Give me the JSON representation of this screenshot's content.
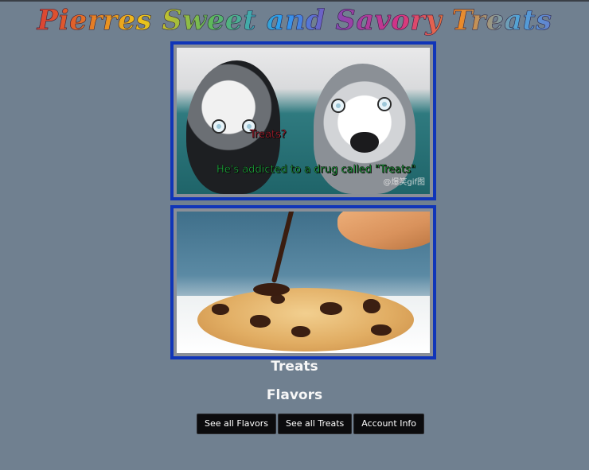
{
  "site": {
    "title": "Pierres Sweet and Savory Treats"
  },
  "gallery": {
    "dogs_image": {
      "caption_question": "Treats?",
      "caption_answer": "He's addicted to a drug called \"Treats\"",
      "watermark": "@爆笑gif图"
    },
    "cookie_image": {}
  },
  "sections": {
    "treats_heading": "Treats",
    "flavors_heading": "Flavors"
  },
  "nav_buttons": {
    "flavors": "See all Flavors",
    "treats": "See all Treats",
    "account": "Account Info"
  },
  "colors": {
    "page_background": "#708090",
    "image_border": "#1035b8",
    "button_background": "#0b0b0d",
    "caption_red": "#e0243a",
    "caption_green": "#22d14a"
  }
}
